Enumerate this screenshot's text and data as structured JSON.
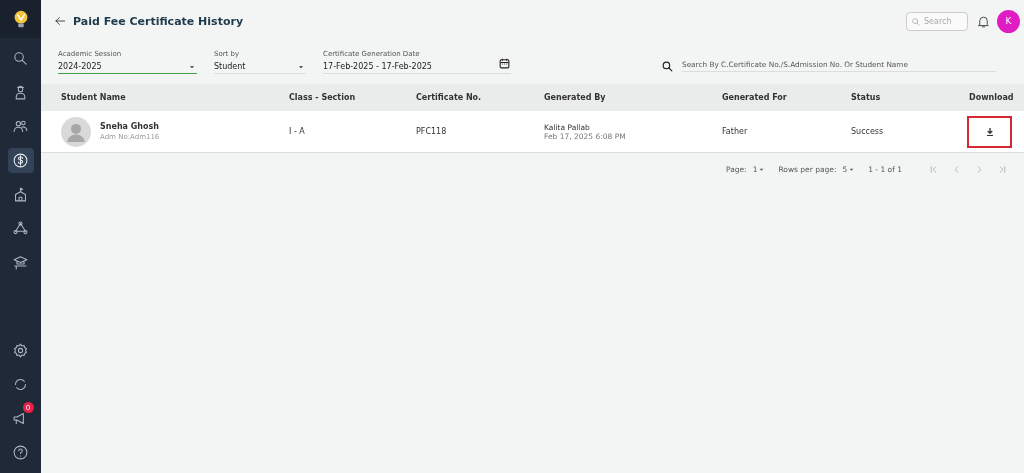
{
  "sidebar": {
    "top_items": [
      {
        "selected": false
      },
      {
        "selected": false
      },
      {
        "selected": false
      },
      {
        "selected": true
      },
      {
        "selected": false
      },
      {
        "selected": false
      },
      {
        "selected": false
      }
    ],
    "bottom_items": [
      {
        "selected": false
      },
      {
        "selected": false
      },
      {
        "selected": false,
        "badge": "0"
      },
      {
        "selected": false
      }
    ]
  },
  "header": {
    "title": "Paid Fee Certificate History",
    "search": {
      "placeholder": "Search"
    },
    "avatar": "K"
  },
  "filters": [
    {
      "kind": "select",
      "label": "Academic Session",
      "value": "2024-2025",
      "focused": true
    },
    {
      "kind": "select",
      "label": "Sort by",
      "value": "Student",
      "focused": false
    },
    {
      "kind": "date",
      "label": "Certificate Generation Date",
      "value": "17-Feb-2025 - 17-Feb-2025",
      "focused": false
    }
  ],
  "search": {
    "placeholder": "Search By C.Certificate No./S.Admission No. Or Student Name"
  },
  "table": {
    "columns": [
      "Student Name",
      "Class - Section",
      "Certificate No.",
      "Generated By",
      "Generated For",
      "Status",
      "Download"
    ],
    "rows": [
      {
        "name": "Sneha Ghosh",
        "adm": "Adm No:Adm116",
        "class_section": "I - A",
        "certificate_no": "PFC118",
        "generated_by": "Kalita Pallab",
        "generated_at": "Feb 17, 2025 6:08 PM",
        "generated_for": "Father",
        "status": "Success",
        "download_highlighted": true
      }
    ]
  },
  "pagination": {
    "page_label": "Page:",
    "page": "1",
    "rows_label": "Rows per page:",
    "rows": "5",
    "range": "1 - 1 of 1"
  }
}
